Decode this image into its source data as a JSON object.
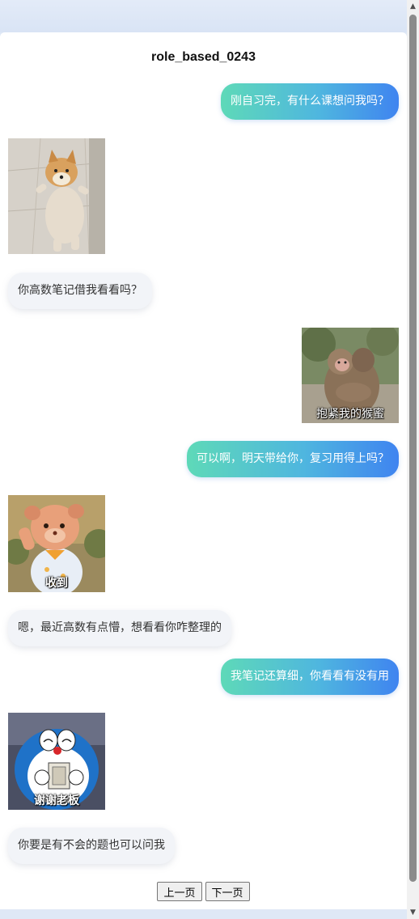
{
  "title": "role_based_0243",
  "messages": [
    {
      "side": "right",
      "type": "text",
      "text": "刚自习完，有什么课想问我吗？"
    },
    {
      "side": "left",
      "type": "sticker",
      "sticker": "shiba-dog-dancing"
    },
    {
      "side": "left",
      "type": "text",
      "text": "你高数笔记借我看看吗？"
    },
    {
      "side": "right",
      "type": "sticker",
      "sticker": "monkeys-hugging",
      "caption": "抱紧我的猴蜜"
    },
    {
      "side": "right",
      "type": "text",
      "text": "可以啊，明天带给你，复习用得上吗？"
    },
    {
      "side": "left",
      "type": "sticker",
      "sticker": "bear-costume-saluting",
      "caption": "收到"
    },
    {
      "side": "left",
      "type": "text",
      "text": "嗯，最近高数有点懵，想看看你咋整理的"
    },
    {
      "side": "right",
      "type": "text",
      "text": "我笔记还算细，你看看有没有用"
    },
    {
      "side": "left",
      "type": "sticker",
      "sticker": "doraemon-with-money",
      "caption": "谢谢老板"
    },
    {
      "side": "left",
      "type": "text",
      "text": "你要是有不会的题也可以问我"
    }
  ],
  "pager": {
    "prev_label": "上一页",
    "next_label": "下一页"
  },
  "colors": {
    "bubble_right_gradient": [
      "#5ed9b8",
      "#3f84f0"
    ],
    "bubble_left": "#f2f4f8",
    "page_background": "#dfe8f6"
  }
}
